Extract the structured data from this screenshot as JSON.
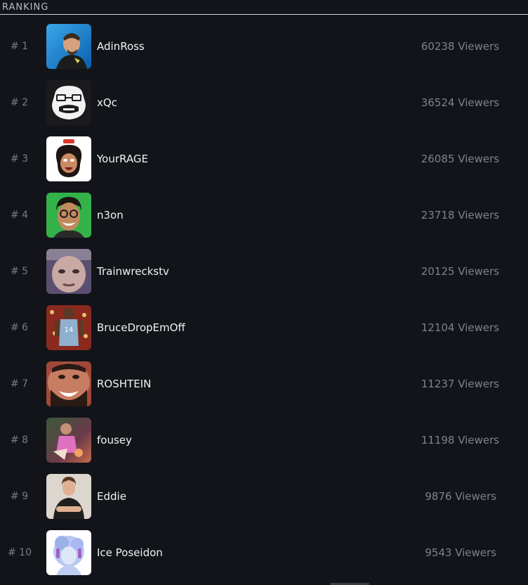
{
  "header": {
    "title": "RANKING"
  },
  "rows": [
    {
      "rank": "# 1",
      "name": "AdinRoss",
      "viewers": "60238 Viewers",
      "avatar_icon": "avatar-adinross"
    },
    {
      "rank": "# 2",
      "name": "xQc",
      "viewers": "36524 Viewers",
      "avatar_icon": "avatar-xqc"
    },
    {
      "rank": "# 3",
      "name": "YourRAGE",
      "viewers": "26085 Viewers",
      "avatar_icon": "avatar-yourrage"
    },
    {
      "rank": "# 4",
      "name": "n3on",
      "viewers": "23718 Viewers",
      "avatar_icon": "avatar-n3on"
    },
    {
      "rank": "# 5",
      "name": "Trainwreckstv",
      "viewers": "20125 Viewers",
      "avatar_icon": "avatar-trainwreckstv"
    },
    {
      "rank": "# 6",
      "name": "BruceDropEmOff",
      "viewers": "12104 Viewers",
      "avatar_icon": "avatar-brucedropemoff"
    },
    {
      "rank": "# 7",
      "name": "ROSHTEIN",
      "viewers": "11237 Viewers",
      "avatar_icon": "avatar-roshtein"
    },
    {
      "rank": "# 8",
      "name": "fousey",
      "viewers": "11198 Viewers",
      "avatar_icon": "avatar-fousey"
    },
    {
      "rank": "# 9",
      "name": "Eddie",
      "viewers": "9876 Viewers",
      "avatar_icon": "avatar-eddie"
    },
    {
      "rank": "# 10",
      "name": "Ice Poseidon",
      "viewers": "9543 Viewers",
      "avatar_icon": "avatar-iceposeidon"
    }
  ]
}
